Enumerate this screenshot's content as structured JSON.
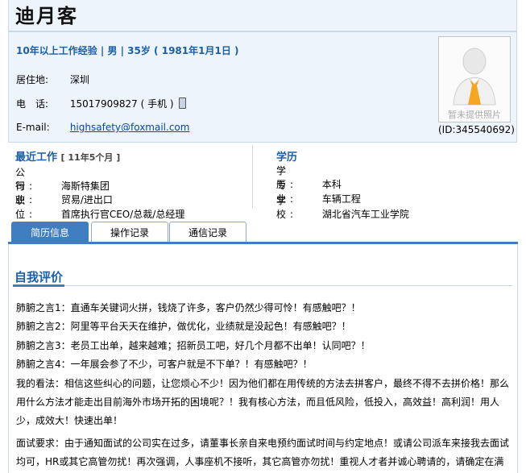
{
  "profile": {
    "name": "迪月客",
    "summary": "10年以上工作经验 | 男 | 35岁 ( 1981年1月1日 )",
    "residence_label": "居住地:",
    "residence_value": "深圳",
    "phone_label": "电　话:",
    "phone_value": "15017909827 ( 手机 )",
    "email_label": "E-mail:",
    "email_value": "highsafety@foxmail.com",
    "photo_caption": "暂未提供照片",
    "id_text": "(ID:345540692)"
  },
  "work": {
    "title": "最近工作",
    "duration": "[ 11年5个月 ]",
    "items": [
      {
        "label": "公　司:",
        "value": "海斯特集团"
      },
      {
        "label": "行　业:",
        "value": "贸易/进出口"
      },
      {
        "label": "职　位:",
        "value": "首席执行官CEO/总裁/总经理"
      }
    ]
  },
  "education": {
    "title": "学历",
    "items": [
      {
        "label": "学　历:",
        "value": "本科"
      },
      {
        "label": "专　业:",
        "value": "车辆工程"
      },
      {
        "label": "学　校:",
        "value": "湖北省汽车工业学院"
      }
    ]
  },
  "tabs": [
    {
      "label": "简历信息",
      "active": true
    },
    {
      "label": "操作记录",
      "active": false
    },
    {
      "label": "通信记录",
      "active": false
    }
  ],
  "self_eval": {
    "title": "自我评价",
    "lines": [
      "肺腑之言1：直通车关键词火拼，钱烧了许多，客户仍然少得可怜！有感触吧？！",
      "肺腑之言2：阿里等平台天天在维护，做优化，业绩就是没起色！有感触吧？！",
      "肺腑之言3：老员工出单，越来越难；招新员工吧，好几个月都不出单！认同吧？！",
      "肺腑之言4：一年展会参了不少，可客户就是不下单？！有感触吧？！",
      "我的看法：相信这些纠心的问题，让您烦心不少！因为他们都在用传统的方法去拼客户，最终不得不去拼价格！那么用什么方法才能走出目前海外市场开拓的困境呢？！我有核心方法，而且低风险，低投入，高效益！高利润！用人少，成效大！快速出单！",
      "面试要求：由于通知面试的公司实在过多，请董事长亲自来电预约面试时间与约定地点！或请公司派车来接我去面试均可，HR或其它高管勿扰！再次强调，人事座机不接听，其它高管亦勿扰！重视人才者并诚心聘请的，请确定在满足"
    ]
  },
  "colors": {
    "accent": "#1b5fa8",
    "tab_active": "#3f7fc1",
    "header_bg": "#eef4fb"
  }
}
